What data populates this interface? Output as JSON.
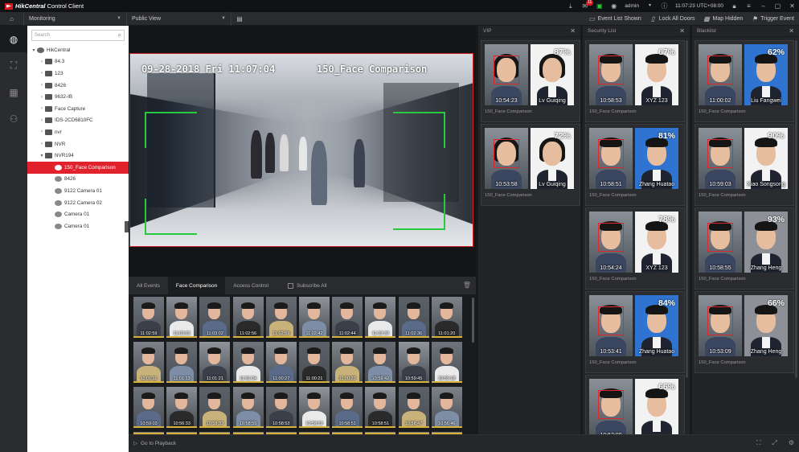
{
  "app": {
    "brand_bold": "HikCentral",
    "brand_rest": "Control Client",
    "user": "admin",
    "clock": "11:07:23 UTC+08:00",
    "notif_count": "11"
  },
  "menubar": {
    "module": "Monitoring",
    "view": "Public View",
    "actions": [
      "Event List Shown",
      "Lock All Doors",
      "Map Hidden",
      "Trigger Event"
    ]
  },
  "tree": {
    "search_placeholder": "Search",
    "root": "HikCentral",
    "nodes": [
      {
        "label": "84.3",
        "type": "dev"
      },
      {
        "label": "123",
        "type": "dev"
      },
      {
        "label": "8426",
        "type": "dev"
      },
      {
        "label": "9632-IB",
        "type": "dev"
      },
      {
        "label": "Face Capture",
        "type": "dev"
      },
      {
        "label": "IDS-2CD6810FC",
        "type": "dev"
      },
      {
        "label": "nvr",
        "type": "dev"
      },
      {
        "label": "NVR",
        "type": "dev"
      },
      {
        "label": "NVR194",
        "type": "dev",
        "expanded": true
      }
    ],
    "cameras": [
      "150_Face Comparison",
      "8426",
      "9122 Camera 01",
      "9122 Camera 02",
      "Camera 01",
      "Camera 01"
    ]
  },
  "video": {
    "osd_time": "09-28-2018 Fri 11:07:04",
    "osd_name": "150_Face Comparison"
  },
  "events": {
    "tabs": [
      "All Events",
      "Face Comparison",
      "Access Control"
    ],
    "active": 1,
    "subscribe": "Subscribe All",
    "rows": [
      [
        "11:02:59",
        "11:03:02",
        "11:03:02",
        "11:02:56",
        "11:02:59",
        "11:02:42",
        "11:02:44",
        "11:02:39",
        "11:02:36",
        "11:01:20"
      ],
      [
        "11:01:11",
        "11:01:13",
        "11:01:21",
        "11:01:04",
        "11:00:27",
        "11:00:21",
        "11:00:20",
        "10:59:42",
        "10:59:45",
        "10:59:18"
      ],
      [
        "10:59:03",
        "10:56:33",
        "10:58:33",
        "10:58:55",
        "10:58:53",
        "10:58:53",
        "10:58:51",
        "10:58:51",
        "10:58:47",
        "10:56:46"
      ]
    ]
  },
  "bottom": {
    "playback": "Go to Playback"
  },
  "columns": [
    {
      "title": "VIP",
      "cards": [
        {
          "pct": "87%",
          "time": "10:54:23",
          "name": "Lv Guiqing",
          "src": "150_Face Comparison",
          "ref": "white",
          "fem": true
        },
        {
          "pct": "72%",
          "time": "10:53:58",
          "name": "Lv Guiqing",
          "src": "150_Face Comparison",
          "ref": "white",
          "fem": true
        }
      ]
    },
    {
      "title": "Security List",
      "cards": [
        {
          "pct": "67%",
          "time": "10:58:53",
          "name": "XYZ 123",
          "src": "150_Face Comparison",
          "ref": "white"
        },
        {
          "pct": "81%",
          "time": "10:58:51",
          "name": "Zhang Huatao",
          "src": "150_Face Comparison",
          "ref": "blue"
        },
        {
          "pct": "78%",
          "time": "10:54:24",
          "name": "XYZ 123",
          "src": "150_Face Comparison",
          "ref": "white"
        },
        {
          "pct": "84%",
          "time": "10:53:41",
          "name": "Zhang Huatao",
          "src": "150_Face Comparison",
          "ref": "blue"
        },
        {
          "pct": "66%",
          "time": "10:53:09",
          "name": "",
          "src": "",
          "ref": "white"
        }
      ]
    },
    {
      "title": "Blacklist",
      "cards": [
        {
          "pct": "62%",
          "time": "11:00:02",
          "name": "Liu Fangwei",
          "src": "150_Face Comparison",
          "ref": "blue"
        },
        {
          "pct": "90%",
          "time": "10:59:03",
          "name": "Xiao Songsong",
          "src": "150_Face Comparison",
          "ref": "white"
        },
        {
          "pct": "93%",
          "time": "10:58:55",
          "name": "Zhang Heng",
          "src": "150_Face Comparison",
          "ref": "grey"
        },
        {
          "pct": "66%",
          "time": "10:53:09",
          "name": "Zhang Heng",
          "src": "150_Face Comparison",
          "ref": "grey"
        }
      ]
    }
  ]
}
